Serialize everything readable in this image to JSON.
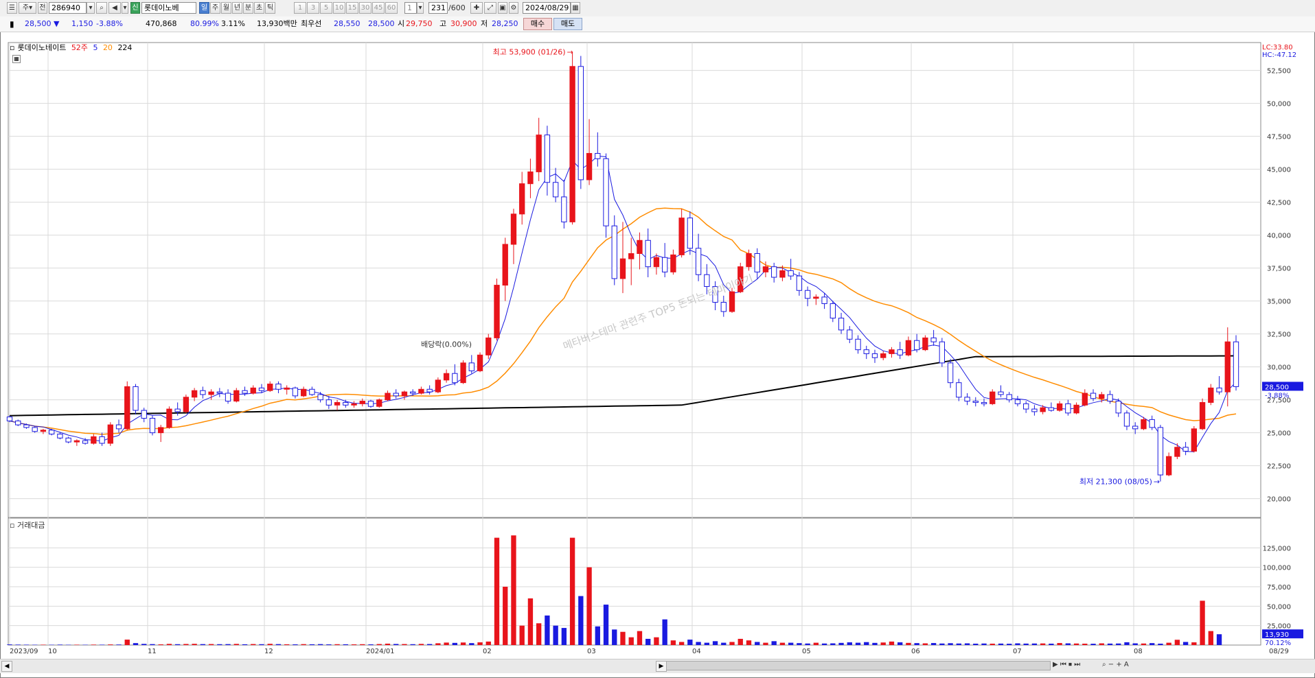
{
  "toolbar": {
    "period_selector": "주",
    "chart_mode": "전",
    "stock_code": "286940",
    "market_badge": "신",
    "stock_name": "롯데이노베",
    "period_tabs": [
      "일",
      "주",
      "월",
      "년",
      "분",
      "초",
      "틱"
    ],
    "selected_period": "일",
    "interval_buttons": [
      "1",
      "3",
      "5",
      "10",
      "15",
      "30",
      "45",
      "60"
    ],
    "interval_value": "1",
    "count_value": "231",
    "count_total": "/600",
    "date_value": "2024/08/29"
  },
  "quote": {
    "price": "28,500",
    "change": "1,150",
    "change_pct": "-3.88%",
    "volume": "470,868",
    "ratio1": "80.99%",
    "ratio2": "3.11%",
    "amount": "13,930백만",
    "best_label": "최우선",
    "best_ask": "28,550",
    "best_bid": "28,500",
    "open_label": "시",
    "open": "29,750",
    "high_label": "고",
    "high": "30,900",
    "low_label": "저",
    "low": "28,250",
    "buy_label": "매수",
    "sell_label": "매도"
  },
  "legend": {
    "name": "롯데이노베이트",
    "ma52": "52주",
    "ma5": "5",
    "ma20": "20",
    "ma224": "224"
  },
  "volume_panel": {
    "title": "거래대금"
  },
  "colors": {
    "up": "#e8141b",
    "down": "#1a1ae0",
    "ma5": "#1a1ae0",
    "ma20": "#ff8c00",
    "ma224": "#000000",
    "grid": "#d9d9d9"
  },
  "icons": [
    "settings-icon",
    "search-icon",
    "sound-icon",
    "calendar-icon",
    "save-icon",
    "gear-icon"
  ],
  "chart_data": {
    "type": "candlestick",
    "title": "롯데이노베이트",
    "y_price_ticks": [
      20000,
      22500,
      25000,
      27500,
      30000,
      32500,
      35000,
      37500,
      40000,
      42500,
      45000,
      47500,
      50000,
      52500
    ],
    "y_price_tick_labels": [
      "20,000",
      "22,500",
      "25,000",
      "27,500",
      "30,000",
      "32,500",
      "35,000",
      "37,500",
      "40,000",
      "42,500",
      "45,000",
      "47,500",
      "50,000",
      "52,500"
    ],
    "ylim_price": [
      19200,
      54300
    ],
    "x_labels": [
      "2023/09",
      "10",
      "11",
      "12",
      "2024/01",
      "02",
      "03",
      "04",
      "05",
      "06",
      "07",
      "08"
    ],
    "end_date_label": "08/29",
    "annotations": {
      "high": "최고 53,900 (01/26)",
      "low": "최저 21,300 (08/05)",
      "dividend": "배당락(0.00%)",
      "watermark": "메타버스테마 관련주 TOP5 돈되는 테마이야기"
    },
    "right_labels": {
      "lc": "LC:33.80",
      "hc": "HC:-47.12",
      "last_price": "28,500",
      "last_change": "-3.88%",
      "last_volume": "13,930",
      "vol_ratio": "70.12%"
    },
    "y_volume_ticks": [
      25000,
      50000,
      75000,
      100000,
      125000
    ],
    "y_volume_tick_labels": [
      "25,000",
      "50,000",
      "75,000",
      "100,000",
      "125,000"
    ],
    "ylim_volume": [
      0,
      150000
    ],
    "candles_ohlc": [
      [
        26200,
        26300,
        25800,
        25900
      ],
      [
        25900,
        26000,
        25500,
        25600
      ],
      [
        25600,
        25700,
        25300,
        25400
      ],
      [
        25400,
        25500,
        25000,
        25100
      ],
      [
        25100,
        25300,
        24900,
        25200
      ],
      [
        25200,
        25300,
        24800,
        24900
      ],
      [
        24900,
        25000,
        24500,
        24600
      ],
      [
        24600,
        24700,
        24200,
        24300
      ],
      [
        24300,
        24500,
        24000,
        24400
      ],
      [
        24400,
        24600,
        24100,
        24200
      ],
      [
        24200,
        24900,
        24100,
        24700
      ],
      [
        24700,
        25000,
        24000,
        24200
      ],
      [
        24200,
        25800,
        24000,
        25600
      ],
      [
        25600,
        26000,
        25000,
        25300
      ],
      [
        25300,
        28900,
        25200,
        28500
      ],
      [
        28500,
        28700,
        26400,
        26700
      ],
      [
        26700,
        26900,
        25800,
        26100
      ],
      [
        26100,
        26300,
        24800,
        25000
      ],
      [
        25000,
        25600,
        24300,
        25400
      ],
      [
        25400,
        27000,
        25300,
        26800
      ],
      [
        26800,
        27300,
        26300,
        26600
      ],
      [
        26600,
        27900,
        26500,
        27700
      ],
      [
        27700,
        28400,
        27400,
        28200
      ],
      [
        28200,
        28500,
        27600,
        27900
      ],
      [
        27900,
        28300,
        27500,
        28100
      ],
      [
        28100,
        28400,
        27700,
        28000
      ],
      [
        28000,
        28300,
        27200,
        27400
      ],
      [
        27400,
        28400,
        27300,
        28200
      ],
      [
        28200,
        28500,
        27800,
        28000
      ],
      [
        28000,
        28600,
        27900,
        28400
      ],
      [
        28400,
        28700,
        28000,
        28200
      ],
      [
        28200,
        28900,
        28100,
        28700
      ],
      [
        28700,
        28900,
        28000,
        28300
      ],
      [
        28300,
        28600,
        27900,
        28400
      ],
      [
        28400,
        28500,
        27600,
        27800
      ],
      [
        27800,
        28500,
        27700,
        28300
      ],
      [
        28300,
        28500,
        27800,
        27900
      ],
      [
        27900,
        28100,
        27300,
        27500
      ],
      [
        27500,
        27800,
        26800,
        27100
      ],
      [
        27100,
        27500,
        26700,
        27300
      ],
      [
        27300,
        27500,
        26900,
        27100
      ],
      [
        27100,
        27400,
        26900,
        27200
      ],
      [
        27200,
        27600,
        27000,
        27400
      ],
      [
        27400,
        27500,
        26900,
        27000
      ],
      [
        27000,
        27600,
        26900,
        27500
      ],
      [
        27500,
        28200,
        27400,
        28000
      ],
      [
        28000,
        28300,
        27600,
        27800
      ],
      [
        27800,
        28200,
        27500,
        28100
      ],
      [
        28100,
        28300,
        27800,
        28000
      ],
      [
        28000,
        28500,
        27900,
        28300
      ],
      [
        28300,
        28600,
        27900,
        28100
      ],
      [
        28100,
        29200,
        28000,
        29000
      ],
      [
        29000,
        29800,
        28800,
        29500
      ],
      [
        29500,
        30200,
        28600,
        28800
      ],
      [
        28800,
        30500,
        28700,
        30300
      ],
      [
        30300,
        30900,
        29500,
        29700
      ],
      [
        29700,
        31100,
        29600,
        30900
      ],
      [
        30900,
        32500,
        30600,
        32200
      ],
      [
        32200,
        36700,
        32000,
        36200
      ],
      [
        36200,
        39800,
        35000,
        39300
      ],
      [
        39300,
        42000,
        37800,
        41600
      ],
      [
        41600,
        44800,
        40800,
        43900
      ],
      [
        43900,
        45800,
        42800,
        44800
      ],
      [
        44800,
        48900,
        44100,
        47600
      ],
      [
        47600,
        48300,
        43000,
        44000
      ],
      [
        44000,
        45100,
        42500,
        42900
      ],
      [
        42900,
        44200,
        40500,
        41000
      ],
      [
        41000,
        53900,
        40800,
        52800
      ],
      [
        52800,
        53600,
        43500,
        44200
      ],
      [
        44200,
        48800,
        43800,
        46200
      ],
      [
        46200,
        47800,
        45200,
        45800
      ],
      [
        45800,
        46200,
        39800,
        40700
      ],
      [
        40700,
        41500,
        36200,
        36700
      ],
      [
        36700,
        41000,
        35600,
        38200
      ],
      [
        38200,
        39800,
        36200,
        38600
      ],
      [
        38600,
        40200,
        37400,
        39600
      ],
      [
        39600,
        40500,
        36800,
        37600
      ],
      [
        37600,
        38600,
        37000,
        38300
      ],
      [
        38300,
        39400,
        36800,
        37200
      ],
      [
        37200,
        38900,
        37000,
        38500
      ],
      [
        38500,
        42000,
        38300,
        41300
      ],
      [
        41300,
        41800,
        38500,
        39000
      ],
      [
        39000,
        40100,
        36500,
        37000
      ],
      [
        37000,
        37800,
        35500,
        36100
      ],
      [
        36100,
        36500,
        34300,
        34900
      ],
      [
        34900,
        35400,
        33800,
        34200
      ],
      [
        34200,
        36000,
        34100,
        35700
      ],
      [
        35700,
        37900,
        35600,
        37600
      ],
      [
        37600,
        38900,
        37300,
        38600
      ],
      [
        38600,
        39000,
        36700,
        37200
      ],
      [
        37200,
        38000,
        36800,
        37600
      ],
      [
        37600,
        37900,
        36400,
        36800
      ],
      [
        36800,
        37700,
        36500,
        37300
      ],
      [
        37300,
        38200,
        36600,
        36900
      ],
      [
        36900,
        37200,
        35400,
        35800
      ],
      [
        35800,
        36100,
        34600,
        35200
      ],
      [
        35200,
        35500,
        34700,
        35300
      ],
      [
        35300,
        35600,
        34400,
        34800
      ],
      [
        34800,
        35000,
        33400,
        33700
      ],
      [
        33700,
        34100,
        32500,
        32800
      ],
      [
        32800,
        33100,
        31800,
        32100
      ],
      [
        32100,
        32400,
        31000,
        31300
      ],
      [
        31300,
        31600,
        30600,
        31000
      ],
      [
        31000,
        31300,
        30300,
        30700
      ],
      [
        30700,
        31200,
        30500,
        31000
      ],
      [
        31000,
        31500,
        30700,
        31300
      ],
      [
        31300,
        31900,
        30600,
        30900
      ],
      [
        30900,
        32300,
        30800,
        32000
      ],
      [
        32000,
        32500,
        31100,
        31300
      ],
      [
        31300,
        32400,
        31200,
        32200
      ],
      [
        32200,
        32800,
        31600,
        31900
      ],
      [
        31900,
        32200,
        30000,
        30300
      ],
      [
        30300,
        30600,
        28400,
        28800
      ],
      [
        28800,
        29100,
        27400,
        27700
      ],
      [
        27700,
        28000,
        27100,
        27400
      ],
      [
        27400,
        27700,
        27000,
        27300
      ],
      [
        27300,
        27600,
        27000,
        27200
      ],
      [
        27200,
        28300,
        27100,
        28100
      ],
      [
        28100,
        28600,
        27700,
        27900
      ],
      [
        27900,
        28100,
        27300,
        27500
      ],
      [
        27500,
        27800,
        27000,
        27200
      ],
      [
        27200,
        27400,
        26500,
        26800
      ],
      [
        26800,
        27100,
        26300,
        26600
      ],
      [
        26600,
        27100,
        26400,
        26900
      ],
      [
        26900,
        27300,
        26600,
        26700
      ],
      [
        26700,
        27400,
        26600,
        27200
      ],
      [
        27200,
        27500,
        26300,
        26500
      ],
      [
        26500,
        27300,
        26400,
        27100
      ],
      [
        27100,
        28300,
        27000,
        28000
      ],
      [
        28000,
        28300,
        27400,
        27600
      ],
      [
        27600,
        28100,
        27300,
        27900
      ],
      [
        27900,
        28200,
        27200,
        27400
      ],
      [
        27400,
        27600,
        26200,
        26500
      ],
      [
        26500,
        26700,
        25200,
        25500
      ],
      [
        25500,
        25800,
        24900,
        25300
      ],
      [
        25300,
        26200,
        25200,
        26000
      ],
      [
        26000,
        26300,
        25200,
        25400
      ],
      [
        25400,
        25600,
        21300,
        21800
      ],
      [
        21800,
        23500,
        21700,
        23200
      ],
      [
        23200,
        24200,
        23000,
        23900
      ],
      [
        23900,
        24300,
        23300,
        23600
      ],
      [
        23600,
        25500,
        23500,
        25300
      ],
      [
        25300,
        27600,
        25200,
        27300
      ],
      [
        27300,
        28700,
        27100,
        28400
      ],
      [
        28400,
        29300,
        27900,
        28100
      ],
      [
        28100,
        33000,
        27000,
        31900
      ],
      [
        31900,
        32400,
        28200,
        28500
      ]
    ],
    "volume_amount": [
      800,
      600,
      500,
      400,
      500,
      400,
      600,
      400,
      500,
      400,
      600,
      500,
      800,
      700,
      7000,
      2500,
      1500,
      1200,
      900,
      1500,
      1100,
      1400,
      1600,
      1200,
      1300,
      1100,
      1200,
      1500,
      1000,
      1300,
      1100,
      1600,
      1200,
      1000,
      900,
      1200,
      1000,
      1200,
      900,
      1100,
      1000,
      900,
      1100,
      900,
      1300,
      1800,
      1400,
      1300,
      1100,
      1500,
      1300,
      2300,
      3200,
      2800,
      3300,
      2500,
      3500,
      4500,
      138000,
      75000,
      141000,
      25000,
      60000,
      28000,
      38000,
      25000,
      22000,
      138000,
      63000,
      100000,
      24000,
      52000,
      20000,
      17000,
      10000,
      18000,
      8000,
      10000,
      33000,
      6000,
      4000,
      7000,
      4000,
      3000,
      5000,
      3000,
      4000,
      8000,
      6000,
      4000,
      3000,
      5000,
      3000,
      3000,
      2500,
      2000,
      3000,
      2000,
      2200,
      2800,
      3500,
      3000,
      3800,
      2800,
      3300,
      4500,
      3500,
      2800,
      2500,
      2200,
      2600,
      2000,
      2400,
      2000,
      2200,
      1800,
      2000,
      1800,
      1900,
      1700,
      2200,
      1900,
      2000,
      2100,
      1800,
      2600,
      2200,
      2000,
      1800,
      1700,
      2200,
      1900,
      2000,
      3600,
      2200,
      2000,
      2500,
      1800,
      3000,
      6800,
      4000,
      3500,
      57000,
      18000,
      13930
    ]
  }
}
